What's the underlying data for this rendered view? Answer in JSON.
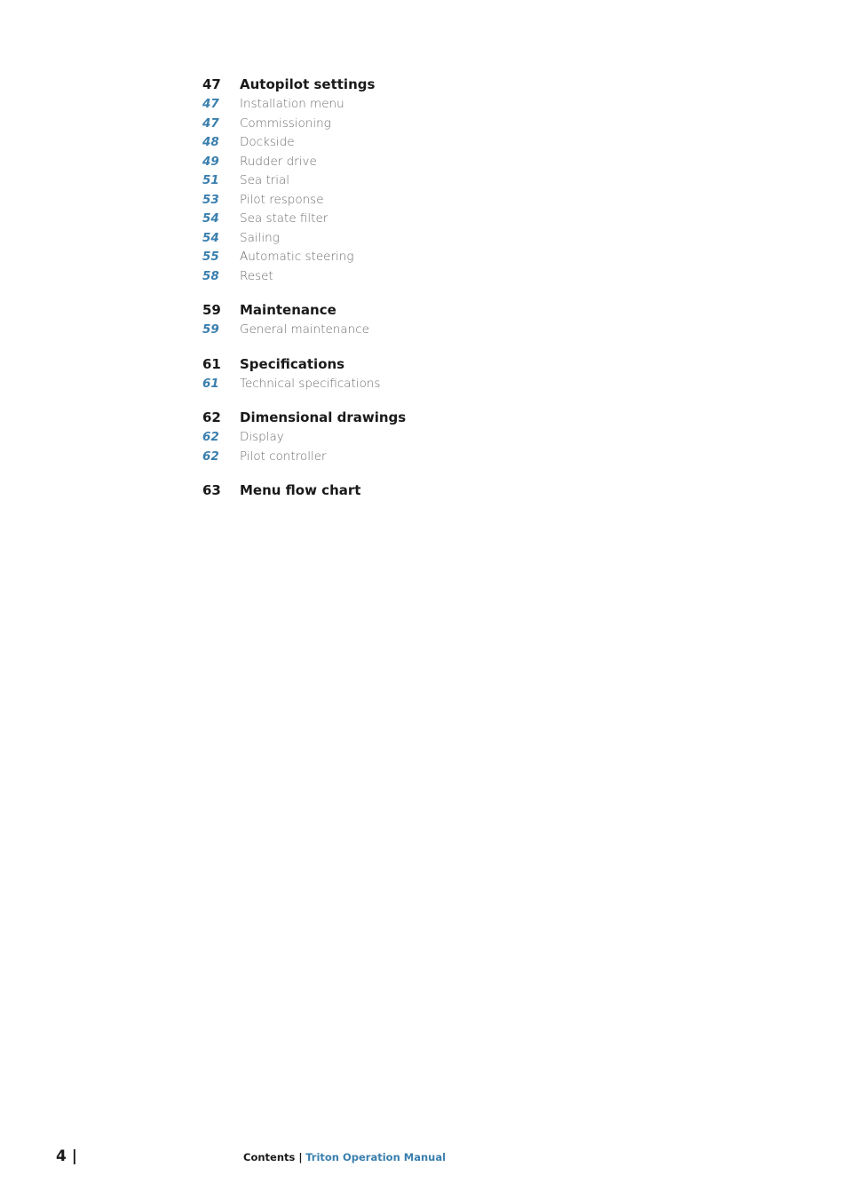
{
  "toc": [
    {
      "page": "47",
      "title": "Autopilot settings",
      "items": [
        {
          "page": "47",
          "title": "Installation menu"
        },
        {
          "page": "47",
          "title": "Commissioning"
        },
        {
          "page": "48",
          "title": "Dockside"
        },
        {
          "page": "49",
          "title": "Rudder drive"
        },
        {
          "page": "51",
          "title": "Sea trial"
        },
        {
          "page": "53",
          "title": "Pilot response"
        },
        {
          "page": "54",
          "title": "Sea state filter"
        },
        {
          "page": "54",
          "title": "Sailing"
        },
        {
          "page": "55",
          "title": "Automatic steering"
        },
        {
          "page": "58",
          "title": "Reset"
        }
      ]
    },
    {
      "page": "59",
      "title": "Maintenance",
      "items": [
        {
          "page": "59",
          "title": "General maintenance"
        }
      ]
    },
    {
      "page": "61",
      "title": "Specifications",
      "items": [
        {
          "page": "61",
          "title": "Technical specifications"
        }
      ]
    },
    {
      "page": "62",
      "title": "Dimensional drawings",
      "items": [
        {
          "page": "62",
          "title": "Display"
        },
        {
          "page": "62",
          "title": "Pilot controller"
        }
      ]
    },
    {
      "page": "63",
      "title": "Menu flow chart",
      "items": []
    }
  ],
  "footer": {
    "page_number": "4 |",
    "section": "Contents |",
    "manual": "Triton Operation Manual"
  }
}
